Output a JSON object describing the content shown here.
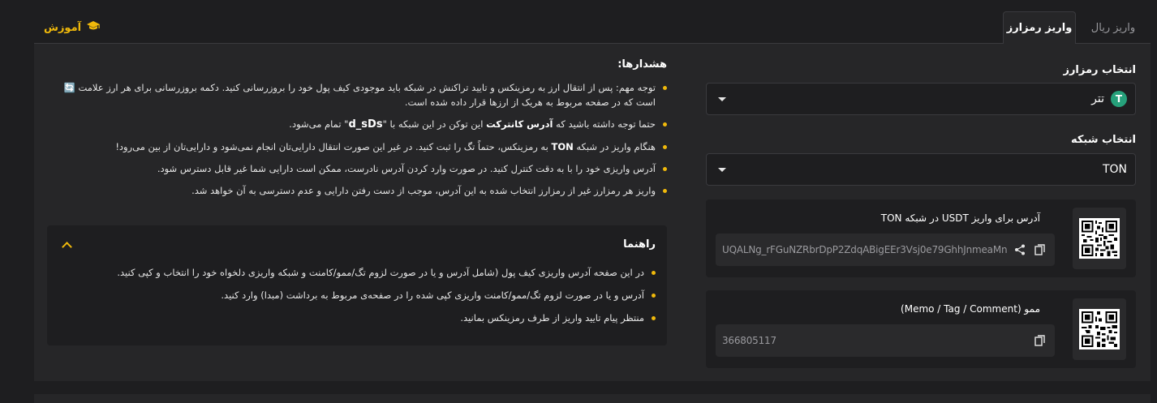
{
  "tabs": {
    "active": "واریز رمزارز",
    "inactive": "واریز ریال"
  },
  "education": {
    "label": "آموزش"
  },
  "form": {
    "coin_label": "انتخاب رمزارز",
    "coin_value": "تتر",
    "coin_icon_letter": "T",
    "network_label": "انتخاب شبکه",
    "network_value": "TON"
  },
  "address_card": {
    "title": "آدرس برای واریز USDT در شبکه TON",
    "value": "UQALNg_rFGuNZRbrDpP2ZdqABigEEr3Vsj0e79GhhJnmeaMn"
  },
  "memo_card": {
    "title": "ممو (Memo / Tag / Comment)",
    "value": "366805117"
  },
  "warnings": {
    "title": "هشدارها:",
    "item1": "توجه مهم: پس از انتقال ارز به رمزینکس و تایید تراکنش در شبکه باید موجودی کیف پول خود را بروزرسانی کنید. دکمه بروزرسانی برای هر ارز علامت 🔄 است که در صفحه مربوط به هریک از ارزها قرار داده شده است.",
    "item2_a": "حتما توجه داشته باشید که ",
    "item2_b": "آدرس کانترکت",
    "item2_c": " این توکن در این شبکه با \"",
    "item2_d": "d_sDs",
    "item2_e": "\" تمام می‌شود.",
    "item3_a": "هنگام واریز در شبکه ",
    "item3_b": "TON",
    "item3_c": " به رمزینکس، حتماً تگ را ثبت کنید. در غیر این صورت انتقال دارایی‌تان انجام نمی‌شود و دارایی‌تان از بین می‌رود!",
    "item4": "آدرس واریزی خود را با به دقت کنترل کنید. در صورت وارد کردن آدرس نادرست، ممکن است دارایی شما غیر قابل دسترس شود.",
    "item5": "واریز هر رمزارز غیر از رمزارز انتخاب شده به این آدرس، موجب از دست رفتن دارایی و عدم دسترسی به آن خواهد شد."
  },
  "guide": {
    "title": "راهنما",
    "item1": "در این صفحه آدرس واریزی کیف پول (شامل آدرس و یا در صورت لزوم تگ/ممو/کامنت و شبکه واریزی دلخواه خود را انتخاب و کپی کنید.",
    "item2": "آدرس و یا در صورت لزوم تگ/ممو/کامنت واریزی کپی شده را در صفحه‌ی مربوط به برداشت (مبدا) وارد کنید.",
    "item3": "منتظر پیام تایید واریز از طرف رمزینکس بمانید."
  },
  "colors": {
    "accent": "#f0b90b",
    "background": "#1e1e20",
    "panel": "#262628",
    "tether": "#26a17b"
  }
}
